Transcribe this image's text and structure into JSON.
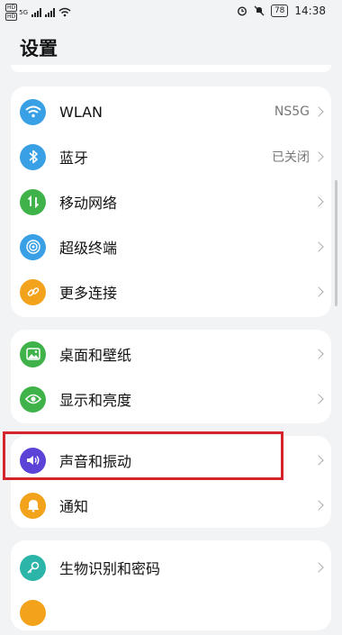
{
  "status": {
    "sim1": "HD",
    "sim2": "HD",
    "network": "5G",
    "battery": "78",
    "time": "14:38"
  },
  "title": "设置",
  "sections": {
    "network": [
      {
        "label": "WLAN",
        "value": "NS5G",
        "icon": "wifi-icon",
        "color": "#3aa0e6"
      },
      {
        "label": "蓝牙",
        "value": "已关闭",
        "icon": "bluetooth-icon",
        "color": "#3aa0e6"
      },
      {
        "label": "移动网络",
        "value": "",
        "icon": "mobile-data-icon",
        "color": "#3fb24a"
      },
      {
        "label": "超级终端",
        "value": "",
        "icon": "super-device-icon",
        "color": "#3aa0e6"
      },
      {
        "label": "更多连接",
        "value": "",
        "icon": "link-icon",
        "color": "#f2a21b"
      }
    ],
    "display": [
      {
        "label": "桌面和壁纸",
        "icon": "wallpaper-icon",
        "color": "#3fb24a"
      },
      {
        "label": "显示和亮度",
        "icon": "eye-icon",
        "color": "#3fb24a"
      }
    ],
    "sound": [
      {
        "label": "声音和振动",
        "icon": "speaker-icon",
        "color": "#5a43d6"
      },
      {
        "label": "通知",
        "icon": "bell-icon",
        "color": "#f2a21b"
      }
    ],
    "security": [
      {
        "label": "生物识别和密码",
        "icon": "key-icon",
        "color": "#2bb5a8"
      },
      {
        "label": "",
        "icon": "apps-icon",
        "color": "#f2a21b"
      }
    ]
  }
}
